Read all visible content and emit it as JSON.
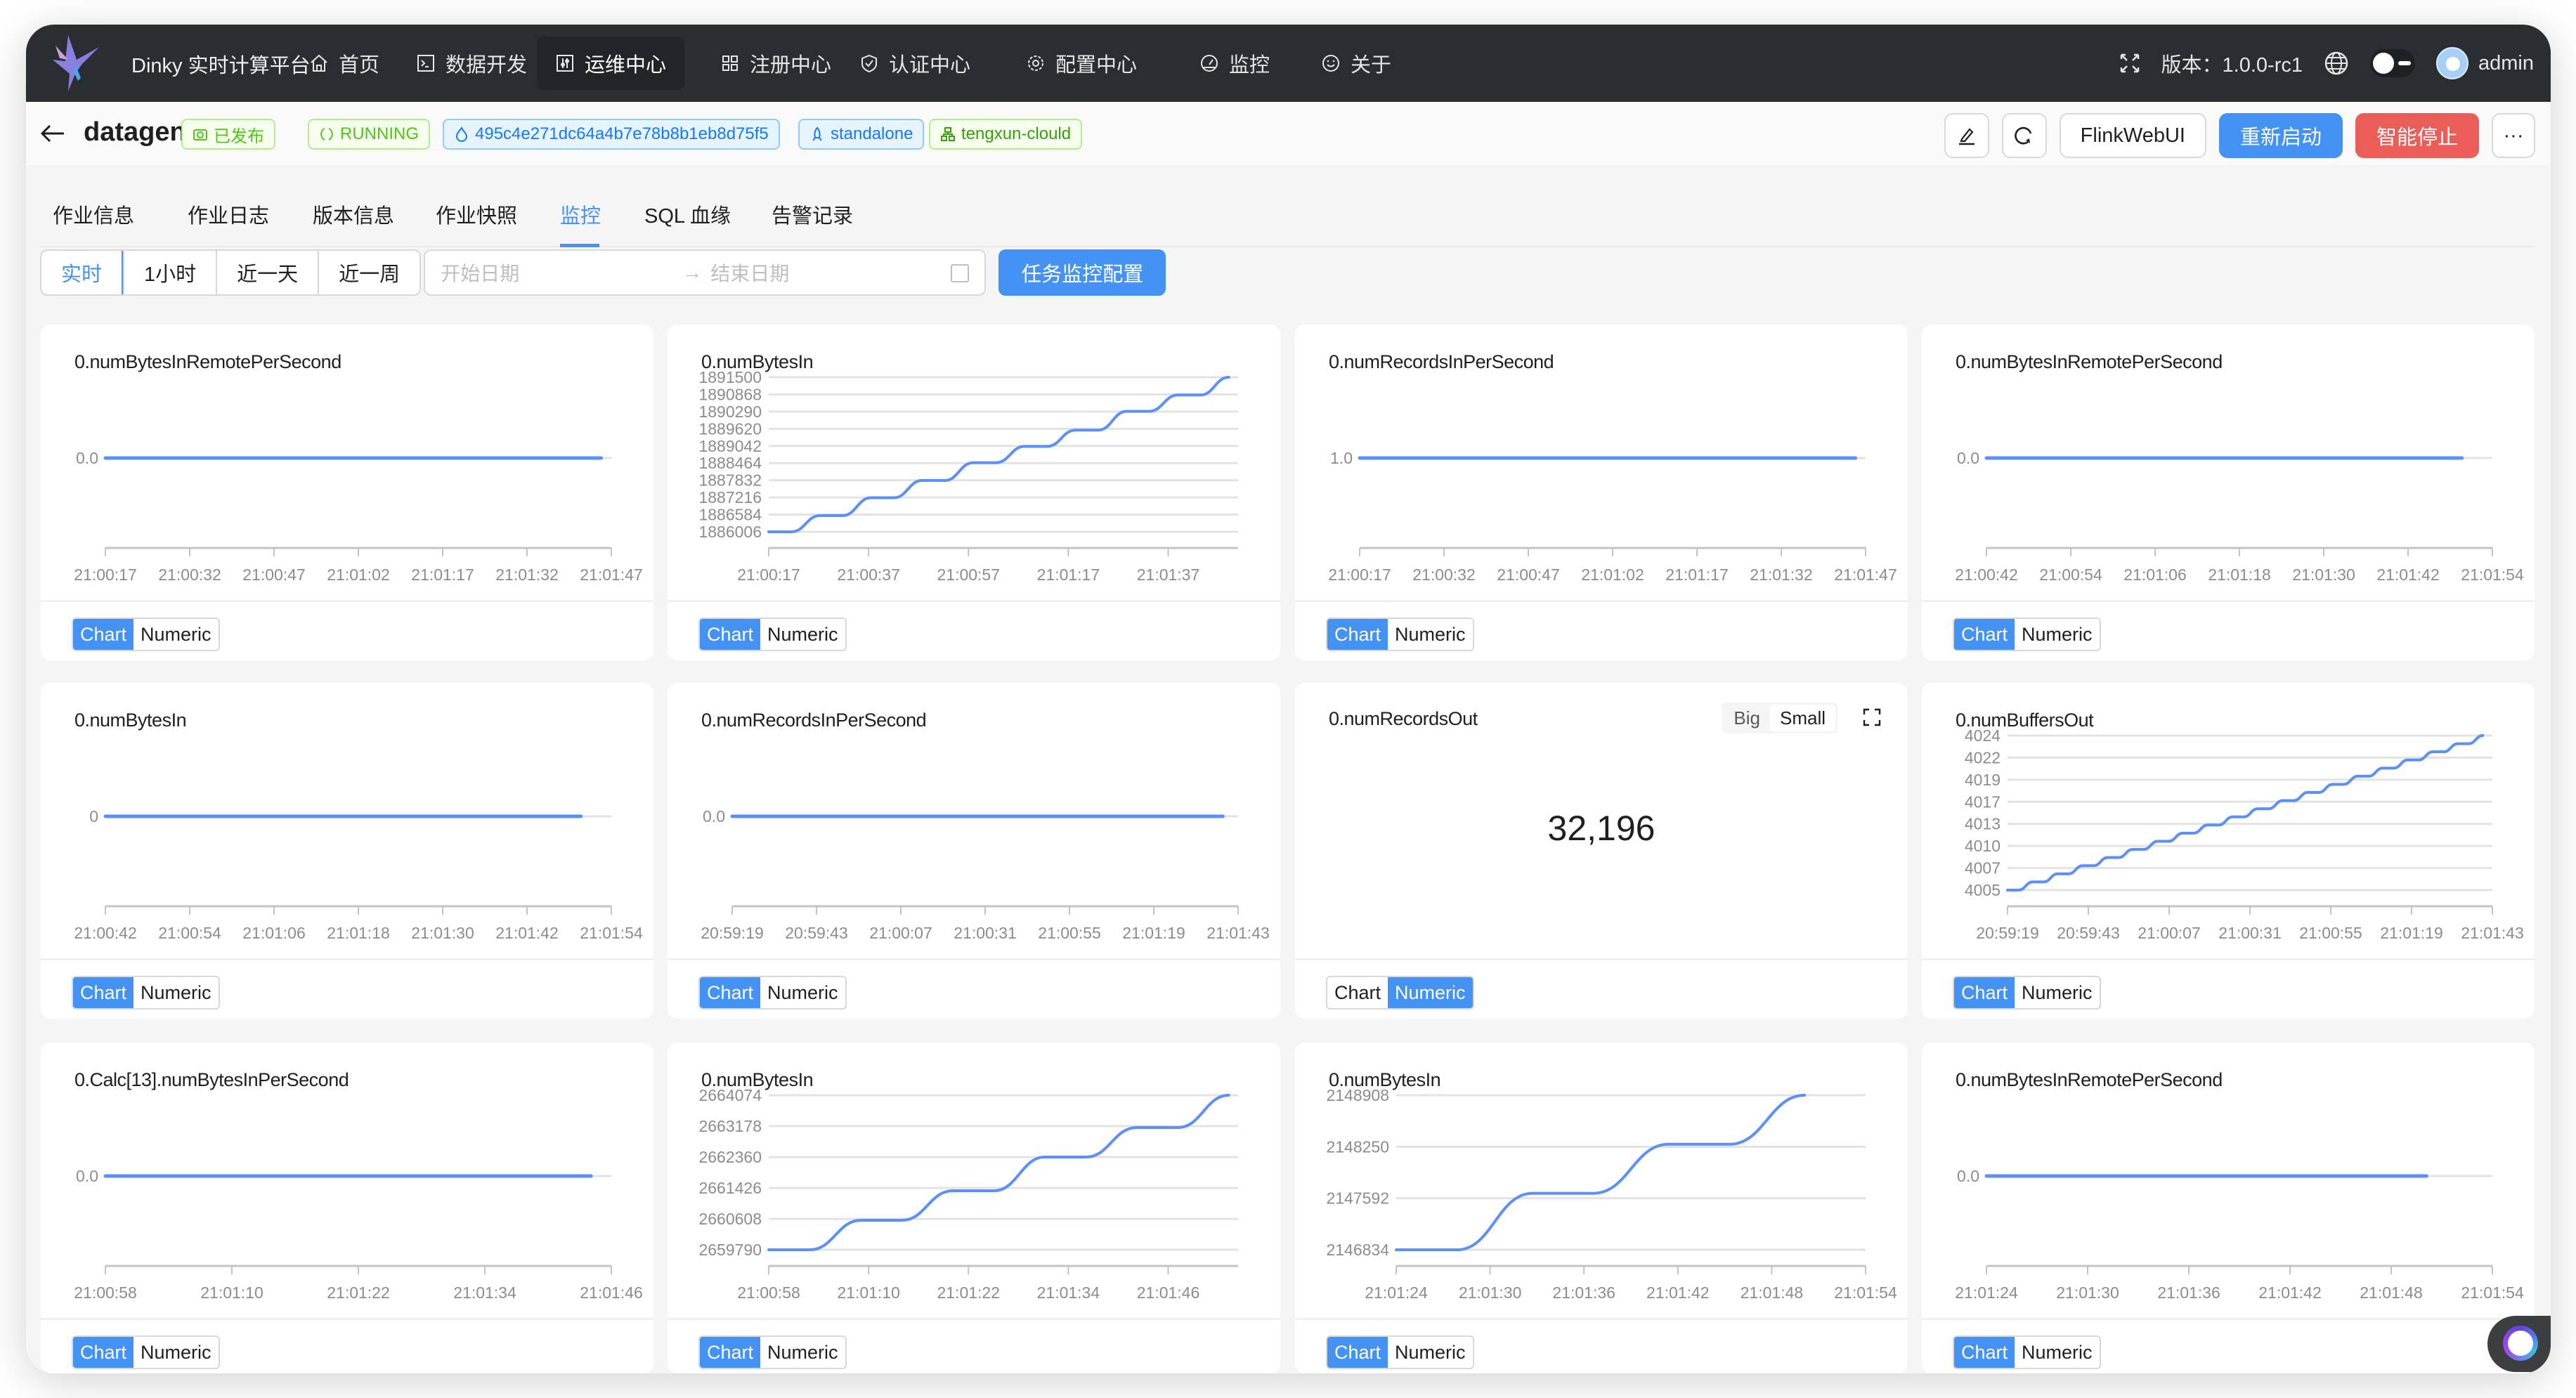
{
  "app": {
    "brand": "Dinky 实时计算平台",
    "nav": [
      {
        "label": "首页",
        "icon": "home-icon",
        "active": false
      },
      {
        "label": "数据开发",
        "icon": "terminal-icon",
        "active": false
      },
      {
        "label": "运维中心",
        "icon": "sliders-icon",
        "active": true
      },
      {
        "label": "注册中心",
        "icon": "grid-icon",
        "active": false
      },
      {
        "label": "认证中心",
        "icon": "shield-check-icon",
        "active": false
      },
      {
        "label": "配置中心",
        "icon": "gear-icon",
        "active": false
      },
      {
        "label": "监控",
        "icon": "dashboard-icon",
        "active": false
      },
      {
        "label": "关于",
        "icon": "smile-icon",
        "active": false
      }
    ],
    "version_label": "版本：1.0.0-rc1",
    "username": "admin"
  },
  "job": {
    "name": "datagen",
    "tags": [
      {
        "label": "已发布",
        "icon": "camera-icon",
        "style": "green"
      },
      {
        "label": "RUNNING",
        "icon": "sync-icon",
        "style": "green"
      },
      {
        "label": "495c4e271dc64a4b7e78b8b1eb8d75f5",
        "icon": "fire-icon",
        "style": "blue"
      },
      {
        "label": "standalone",
        "icon": "rocket-icon",
        "style": "blue"
      },
      {
        "label": "tengxun-clould",
        "icon": "cluster-icon",
        "style": "green-dark"
      }
    ],
    "actions": {
      "edit": "edit-icon",
      "refresh": "refresh-icon",
      "flink_web_ui": "FlinkWebUI",
      "restart": "重新启动",
      "stop": "智能停止",
      "more": "···"
    }
  },
  "tabs": [
    {
      "label": "作业信息",
      "active": false
    },
    {
      "label": "作业日志",
      "active": false
    },
    {
      "label": "版本信息",
      "active": false
    },
    {
      "label": "作业快照",
      "active": false
    },
    {
      "label": "监控",
      "active": true
    },
    {
      "label": "SQL 血缘",
      "active": false
    },
    {
      "label": "告警记录",
      "active": false
    }
  ],
  "filters": {
    "ranges": [
      {
        "label": "实时",
        "active": true
      },
      {
        "label": "1小时",
        "active": false
      },
      {
        "label": "近一天",
        "active": false
      },
      {
        "label": "近一周",
        "active": false
      }
    ],
    "start_placeholder": "开始日期",
    "separator": "→",
    "end_placeholder": "结束日期",
    "config_button": "任务监控配置"
  },
  "switch_labels": {
    "chart": "Chart",
    "numeric": "Numeric",
    "big": "Big",
    "small": "Small"
  },
  "colors": {
    "line": "#5b8ff9",
    "primary": "#4592f5",
    "danger": "#eb5d58"
  },
  "chart_data": [
    {
      "type": "line",
      "title": "0.numBytesInRemotePerSecond",
      "mode": "chart",
      "yticks": [
        "0.0"
      ],
      "xticks": [
        "21:00:17",
        "21:00:32",
        "21:00:47",
        "21:01:02",
        "21:01:17",
        "21:01:32",
        "21:01:47"
      ],
      "flat": true,
      "series": [
        {
          "name": "0.numBytesInRemotePerSecond",
          "values": [
            0,
            0,
            0,
            0,
            0,
            0,
            0
          ]
        }
      ]
    },
    {
      "type": "line",
      "title": "0.numBytesIn",
      "mode": "chart",
      "yticks": [
        "1886006",
        "1886584",
        "1887216",
        "1887832",
        "1888464",
        "1889042",
        "1889620",
        "1890290",
        "1890868",
        "1891500"
      ],
      "xticks": [
        "21:00:17",
        "21:00:37",
        "21:00:57",
        "21:01:17",
        "21:01:37"
      ],
      "step": true,
      "series": [
        {
          "name": "0.numBytesIn",
          "values": [
            1886006,
            1886584,
            1887216,
            1887832,
            1888464,
            1889042,
            1889620,
            1890290,
            1890868,
            1891500
          ]
        }
      ]
    },
    {
      "type": "line",
      "title": "0.numRecordsInPerSecond",
      "mode": "chart",
      "yticks": [
        "1.0"
      ],
      "xticks": [
        "21:00:17",
        "21:00:32",
        "21:00:47",
        "21:01:02",
        "21:01:17",
        "21:01:32",
        "21:01:47"
      ],
      "flat": true,
      "series": [
        {
          "name": "0.numRecordsInPerSecond",
          "values": [
            1,
            1,
            1,
            1,
            1,
            1,
            1
          ]
        }
      ]
    },
    {
      "type": "line",
      "title": "0.numBytesInRemotePerSecond",
      "mode": "chart",
      "yticks": [
        "0.0"
      ],
      "xticks": [
        "21:00:42",
        "21:00:54",
        "21:01:06",
        "21:01:18",
        "21:01:30",
        "21:01:42",
        "21:01:54"
      ],
      "flat": true,
      "end_frac": 0.94,
      "series": [
        {
          "name": "0.numBytesInRemotePerSecond",
          "values": [
            0,
            0,
            0,
            0,
            0,
            0,
            0
          ]
        }
      ]
    },
    {
      "type": "line",
      "title": "0.numBytesIn",
      "mode": "chart",
      "yticks": [
        "0"
      ],
      "xticks": [
        "21:00:42",
        "21:00:54",
        "21:01:06",
        "21:01:18",
        "21:01:30",
        "21:01:42",
        "21:01:54"
      ],
      "flat": true,
      "end_frac": 0.94,
      "series": [
        {
          "name": "0.numBytesIn",
          "values": [
            0,
            0,
            0,
            0,
            0,
            0,
            0
          ]
        }
      ]
    },
    {
      "type": "line",
      "title": "0.numRecordsInPerSecond",
      "mode": "chart",
      "yticks": [
        "0.0"
      ],
      "xticks": [
        "20:59:19",
        "20:59:43",
        "21:00:07",
        "21:00:31",
        "21:00:55",
        "21:01:19",
        "21:01:43"
      ],
      "flat": true,
      "end_frac": 0.97,
      "series": [
        {
          "name": "0.numRecordsInPerSecond",
          "values": [
            0,
            0,
            0,
            0,
            0,
            0,
            0
          ]
        }
      ]
    },
    {
      "type": "numeric",
      "title": "0.numRecordsOut",
      "mode": "numeric",
      "size": "Small",
      "value": "32,196"
    },
    {
      "type": "line",
      "title": "0.numBuffersOut",
      "mode": "chart",
      "yticks": [
        "4005",
        "4007",
        "4010",
        "4013",
        "4017",
        "4019",
        "4022",
        "4024"
      ],
      "xticks": [
        "20:59:19",
        "20:59:43",
        "21:00:07",
        "21:00:31",
        "21:00:55",
        "21:01:19",
        "21:01:43"
      ],
      "step": true,
      "series": [
        {
          "name": "0.numBuffersOut",
          "values": [
            4005,
            4006,
            4007,
            4008,
            4009,
            4010,
            4011,
            4012,
            4013,
            4014,
            4015,
            4016,
            4017,
            4018,
            4019,
            4020,
            4021,
            4022,
            4023,
            4024
          ]
        }
      ]
    },
    {
      "type": "line",
      "title": "0.Calc[13].numBytesInPerSecond",
      "mode": "chart",
      "yticks": [
        "0.0"
      ],
      "xticks": [
        "21:00:58",
        "21:01:10",
        "21:01:22",
        "21:01:34",
        "21:01:46"
      ],
      "flat": true,
      "end_frac": 0.96,
      "series": [
        {
          "name": "0.Calc[13].numBytesInPerSecond",
          "values": [
            0,
            0,
            0,
            0,
            0
          ]
        }
      ]
    },
    {
      "type": "line",
      "title": "0.numBytesIn",
      "mode": "chart",
      "yticks": [
        "2659790",
        "2660608",
        "2661426",
        "2662360",
        "2663178",
        "2664074"
      ],
      "xticks": [
        "21:00:58",
        "21:01:10",
        "21:01:22",
        "21:01:34",
        "21:01:46"
      ],
      "step": true,
      "series": [
        {
          "name": "0.numBytesIn",
          "values": [
            2659790,
            2660608,
            2661426,
            2662360,
            2663178,
            2664074
          ]
        }
      ]
    },
    {
      "type": "line",
      "title": "0.numBytesIn",
      "mode": "chart",
      "yticks": [
        "2146834",
        "2147592",
        "2148250",
        "2148908"
      ],
      "xticks": [
        "21:01:24",
        "21:01:30",
        "21:01:36",
        "21:01:42",
        "21:01:48",
        "21:01:54"
      ],
      "step": true,
      "end_frac": 0.87,
      "series": [
        {
          "name": "0.numBytesIn",
          "values": [
            2146834,
            2147592,
            2148250,
            2148908
          ]
        }
      ]
    },
    {
      "type": "line",
      "title": "0.numBytesInRemotePerSecond",
      "mode": "chart",
      "yticks": [
        "0.0"
      ],
      "xticks": [
        "21:01:24",
        "21:01:30",
        "21:01:36",
        "21:01:42",
        "21:01:48",
        "21:01:54"
      ],
      "flat": true,
      "end_frac": 0.87,
      "series": [
        {
          "name": "0.numBytesInRemotePerSecond",
          "values": [
            0,
            0,
            0,
            0,
            0,
            0
          ]
        }
      ]
    }
  ]
}
